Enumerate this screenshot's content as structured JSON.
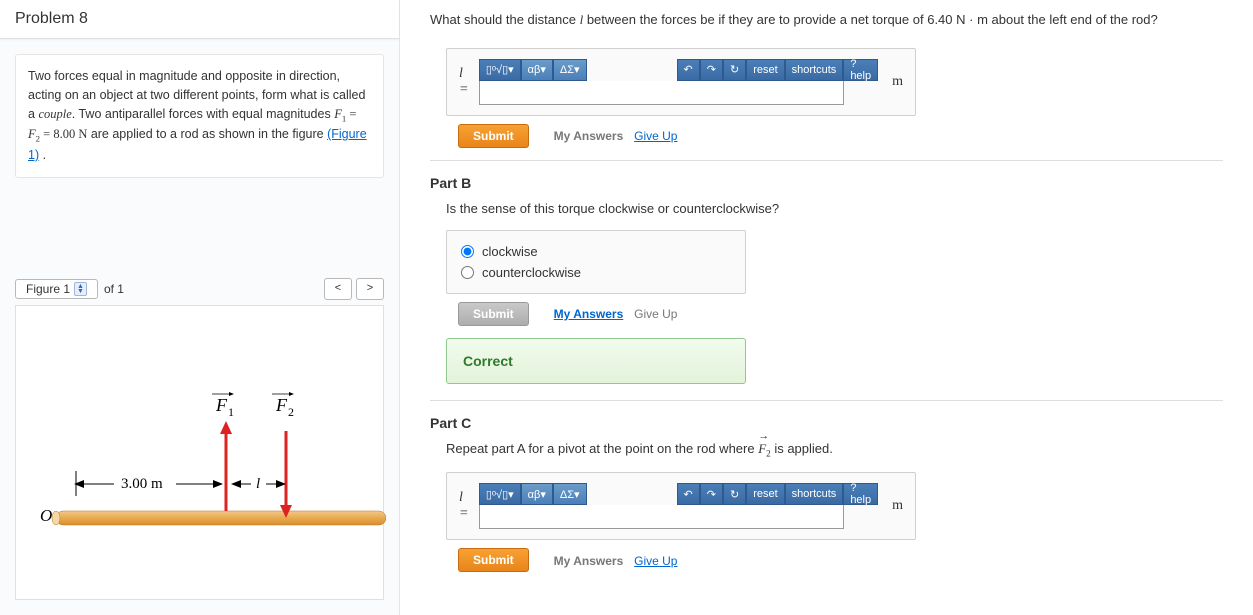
{
  "problem": {
    "title": "Problem 8",
    "description_1": "Two forces equal in magnitude and opposite in direction, acting on an object at two different points, form what is called a ",
    "couple_word": "couple",
    "description_2": ". Two antiparallel forces with equal magnitudes ",
    "eq_text": "F₁ = F₂ = 8.00 N",
    "description_3": " are applied to a rod as shown in the figure ",
    "figure_link": "(Figure 1)",
    "description_4": " ."
  },
  "figure_nav": {
    "label": "Figure 1",
    "of_label": "of 1",
    "prev": "<",
    "next": ">"
  },
  "figure_labels": {
    "F1": "F",
    "F1_sub": "1",
    "F2": "F",
    "F2_sub": "2",
    "dist": "3.00 m",
    "l": "l",
    "O": "O"
  },
  "partA": {
    "question": "What should the distance l between the forces be if they are to provide a net torque of 6.40 N · m about the left end of the rod?",
    "var": "l =",
    "unit": "m",
    "toolbar": {
      "templates": "▯ᵒ√▯▾",
      "greek": "αβ▾",
      "sigma": "ΔΣ▾",
      "undo": "↶",
      "redo": "↷",
      "refresh": "↻",
      "reset": "reset",
      "shortcuts": "shortcuts",
      "help": "? help"
    },
    "submit": "Submit",
    "my_answers": "My Answers",
    "give_up": "Give Up"
  },
  "partB": {
    "title": "Part B",
    "question": "Is the sense of this torque clockwise or counterclockwise?",
    "choice1": "clockwise",
    "choice2": "counterclockwise",
    "submit": "Submit",
    "my_answers": "My Answers",
    "give_up": "Give Up",
    "feedback": "Correct"
  },
  "partC": {
    "title": "Part C",
    "question_1": "Repeat part A for a pivot at the point on the rod where ",
    "F2_text": "F",
    "F2_sub": "2",
    "question_2": " is applied.",
    "var": "l =",
    "unit": "m",
    "submit": "Submit",
    "my_answers": "My Answers",
    "give_up": "Give Up"
  }
}
